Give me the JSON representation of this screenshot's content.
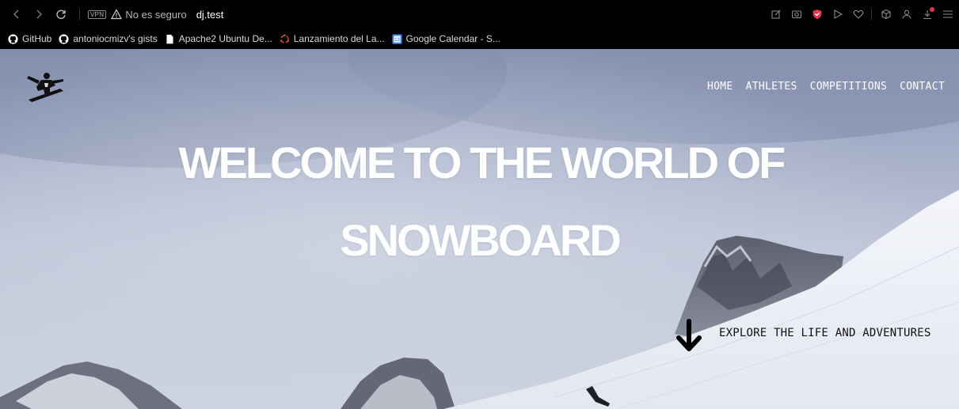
{
  "browser": {
    "vpn_badge": "VPN",
    "security_warning": "No es seguro",
    "url": "dj.test",
    "icons": {
      "back": "back-arrow-icon",
      "forward": "forward-arrow-icon",
      "reload": "reload-icon",
      "warning": "warning-triangle-icon",
      "right_toolbar": [
        "edit-icon",
        "screenshot-icon",
        "shield-icon",
        "play-icon",
        "heart-icon",
        "cube-icon",
        "profile-icon",
        "download-icon",
        "menu-icon"
      ]
    },
    "colors": {
      "chrome_bg": "#000000",
      "shield_red": "#e8344e",
      "notification_dot": "#e8344e"
    }
  },
  "bookmarks": [
    {
      "label": "GitHub",
      "icon": "github-icon"
    },
    {
      "label": "antoniocmizv's gists",
      "icon": "github-icon"
    },
    {
      "label": "Apache2 Ubuntu De...",
      "icon": "document-icon"
    },
    {
      "label": "Lanzamiento del La...",
      "icon": "ubuntu-icon"
    },
    {
      "label": "Google Calendar - S...",
      "icon": "calendar-icon",
      "icon_text": "13"
    }
  ],
  "site": {
    "nav": [
      "HOME",
      "ATHLETES",
      "COMPETITIONS",
      "CONTACT"
    ],
    "hero": {
      "line1": "WELCOME TO THE WORLD OF",
      "line2": "SNOWBOARD"
    },
    "explore": "EXPLORE THE LIFE AND ADVENTURES",
    "icons": {
      "logo": "snowboarder-logo-icon",
      "scroll": "down-arrow-icon"
    }
  }
}
